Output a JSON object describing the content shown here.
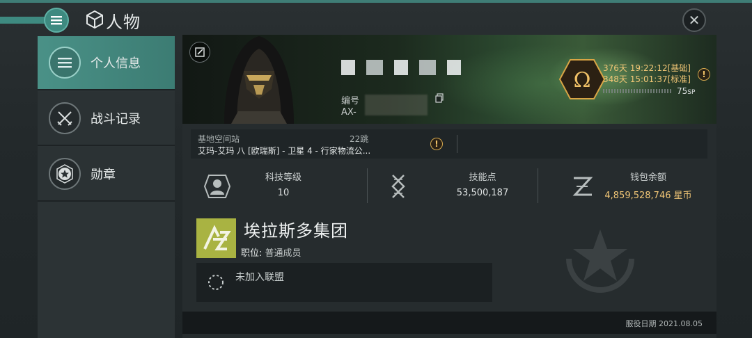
{
  "header": {
    "title": "人物",
    "menu_icon": "hamburger-icon",
    "title_icon": "character-icon",
    "close_icon": "close-icon"
  },
  "sidebar": {
    "items": [
      {
        "label": "个人信息",
        "icon": "list-icon",
        "active": true
      },
      {
        "label": "战斗记录",
        "icon": "crossed-swords-icon",
        "active": false
      },
      {
        "label": "勋章",
        "icon": "star-badge-icon",
        "active": false
      }
    ]
  },
  "profile": {
    "id_label": "编号",
    "id_value": "AX-",
    "omega_symbol": "Ω",
    "timers": [
      "376天 19:22:12[基础]",
      "348天 15:01:37[标准]"
    ],
    "sp_value": "75",
    "sp_unit": "SP",
    "warn_symbol": "!"
  },
  "location": {
    "label": "基地空间站",
    "jumps": "22跳",
    "value": "艾玛-艾玛 八 [欧瑞斯] - 卫星 4 - 行家物流公..."
  },
  "stats": [
    {
      "title": "科技等级",
      "value": "10",
      "icon": "tech-level-icon"
    },
    {
      "title": "技能点",
      "value": "53,500,187",
      "icon": "dna-icon"
    },
    {
      "title": "钱包余额",
      "value": "4,859,528,746 星币",
      "icon": "isk-icon"
    }
  ],
  "corporation": {
    "name": "埃拉斯多集团",
    "role_label": "职位:",
    "role_value": "普通成员"
  },
  "alliance": {
    "text": "未加入联盟"
  },
  "footer": {
    "service_date": "服役日期 2021.08.05"
  },
  "colors": {
    "accent": "#4a9187",
    "gold": "#f1c676",
    "corp_logo": "#a9b342"
  }
}
